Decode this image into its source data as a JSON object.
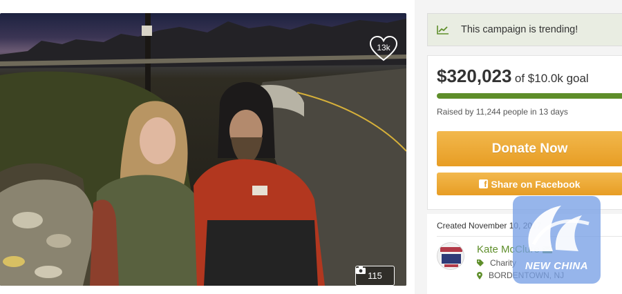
{
  "photo": {
    "favorites_count": "13k",
    "photo_count": "115"
  },
  "trending": {
    "text": "This campaign is trending!"
  },
  "funding": {
    "raised": "$320,023",
    "goal_text": "of $10.0k goal",
    "progress_fraction": 1.0,
    "raised_by": "Raised by 11,244 people in 13 days"
  },
  "actions": {
    "donate_label": "Donate Now",
    "share_label": "Share on Facebook"
  },
  "campaign": {
    "created": "Created November 10, 2017",
    "organizer": "Kate McClure",
    "category": "Charity",
    "location": "BORDENTOWN, NJ"
  },
  "watermark": {
    "text": "NEW CHINA"
  },
  "colors": {
    "accent_green": "#5e8e2a",
    "donate_orange": "#e79d24",
    "trend_background": "#e9ede2"
  },
  "icons": {
    "trend": "chart-line-icon",
    "heart": "heart-icon",
    "camera": "camera-icon",
    "facebook": "facebook-icon",
    "mail": "envelope-icon",
    "tag": "tag-icon",
    "location": "map-pin-icon"
  }
}
